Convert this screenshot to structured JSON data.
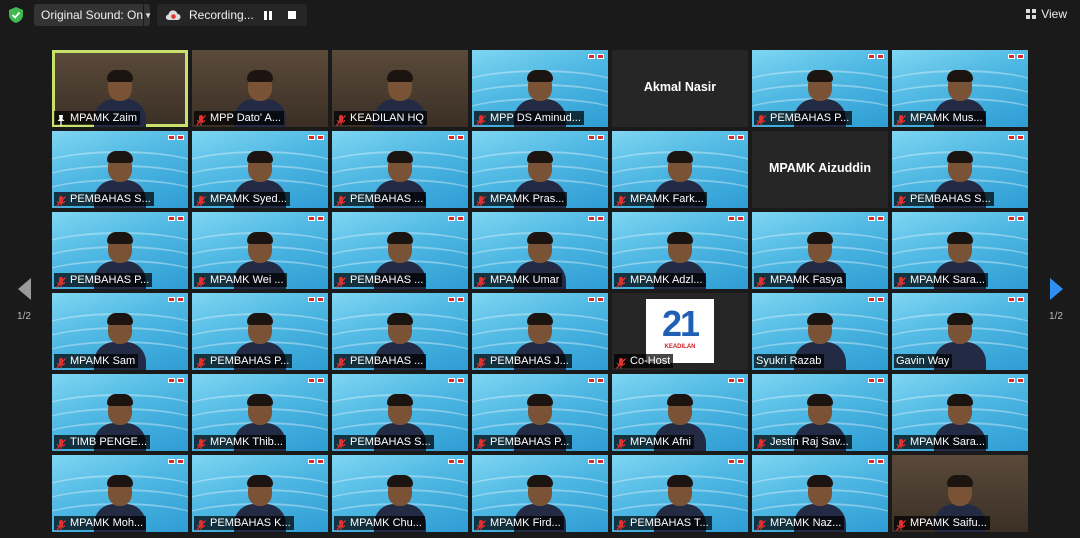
{
  "toolbar": {
    "sound_label": "Original Sound: On",
    "recording_label": "Recording...",
    "view_label": "View"
  },
  "pager": {
    "left": "1/2",
    "right": "1/2"
  },
  "colors": {
    "accent": "#2e8ff0",
    "active_speaker": "#c8e06c",
    "muted_mic": "#e03131",
    "shield": "#3fb950"
  },
  "tiles": [
    {
      "label": "MPAMK Zaim",
      "kind": "room",
      "active": true,
      "mic": "pin"
    },
    {
      "label": "MPP Dato' A...",
      "kind": "room"
    },
    {
      "label": "KEADILAN HQ",
      "kind": "room"
    },
    {
      "label": "MPP DS Aminud...",
      "kind": "video"
    },
    {
      "label": "",
      "kind": "name",
      "display_name": "Akmal Nasir"
    },
    {
      "label": "PEMBAHAS P...",
      "kind": "video"
    },
    {
      "label": "MPAMK Mus...",
      "kind": "video"
    },
    {
      "label": "PEMBAHAS S...",
      "kind": "video"
    },
    {
      "label": "MPAMK Syed...",
      "kind": "video"
    },
    {
      "label": "PEMBAHAS ...",
      "kind": "video"
    },
    {
      "label": "MPAMK Pras...",
      "kind": "video"
    },
    {
      "label": "MPAMK Fark...",
      "kind": "video"
    },
    {
      "label": "",
      "kind": "name",
      "display_name": "MPAMK Aizuddin"
    },
    {
      "label": "PEMBAHAS S...",
      "kind": "video"
    },
    {
      "label": "PEMBAHAS P...",
      "kind": "video"
    },
    {
      "label": "MPAMK Wei ...",
      "kind": "video"
    },
    {
      "label": "PEMBAHAS ...",
      "kind": "video"
    },
    {
      "label": "MPAMK Umar",
      "kind": "video"
    },
    {
      "label": "MPAMK Adzl...",
      "kind": "video"
    },
    {
      "label": "MPAMK Fasya",
      "kind": "video"
    },
    {
      "label": "MPAMK Sara...",
      "kind": "video"
    },
    {
      "label": "MPAMK Sam",
      "kind": "video"
    },
    {
      "label": "PEMBAHAS P...",
      "kind": "video"
    },
    {
      "label": "PEMBAHAS ...",
      "kind": "video"
    },
    {
      "label": "PEMBAHAS J...",
      "kind": "video"
    },
    {
      "label": "Co-Host",
      "kind": "logo21",
      "logo_num": "21",
      "logo_sub": "KEADILAN"
    },
    {
      "label": "Syukri Razab",
      "kind": "video",
      "mic": "none"
    },
    {
      "label": "Gavin Way",
      "kind": "video",
      "mic": "none"
    },
    {
      "label": "TIMB PENGE...",
      "kind": "video"
    },
    {
      "label": "MPAMK Thib...",
      "kind": "video"
    },
    {
      "label": "PEMBAHAS S...",
      "kind": "video"
    },
    {
      "label": "PEMBAHAS P...",
      "kind": "video"
    },
    {
      "label": "MPAMK Afni",
      "kind": "video"
    },
    {
      "label": "Jestin Raj Sav...",
      "kind": "video"
    },
    {
      "label": "MPAMK Sara...",
      "kind": "video"
    },
    {
      "label": "MPAMK Moh...",
      "kind": "video"
    },
    {
      "label": "PEMBAHAS K...",
      "kind": "video"
    },
    {
      "label": "MPAMK Chu...",
      "kind": "video"
    },
    {
      "label": "MPAMK Fird...",
      "kind": "video"
    },
    {
      "label": "PEMBAHAS T...",
      "kind": "video"
    },
    {
      "label": "MPAMK Naz...",
      "kind": "video"
    },
    {
      "label": "MPAMK Saifu...",
      "kind": "room"
    }
  ]
}
